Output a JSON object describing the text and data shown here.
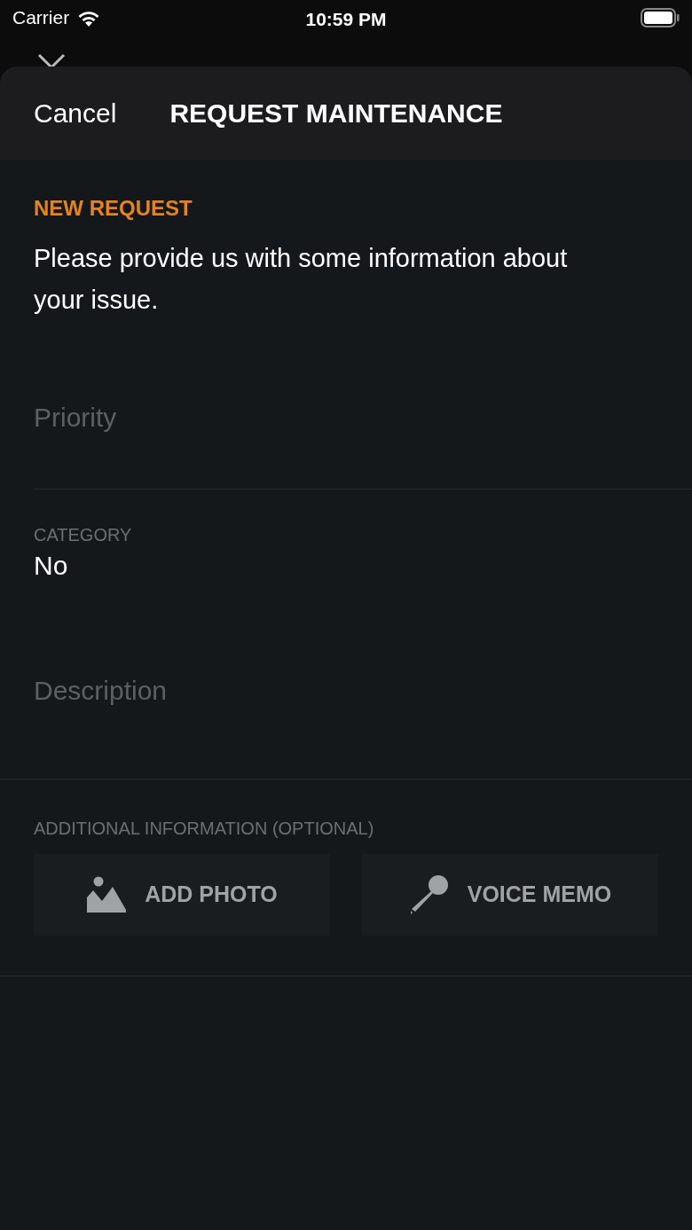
{
  "status_bar": {
    "carrier": "Carrier",
    "time": "10:59 PM"
  },
  "sheet": {
    "cancel": "Cancel",
    "title": "REQUEST MAINTENANCE"
  },
  "section_label": "NEW REQUEST",
  "intro": "Please provide us with some information about your issue.",
  "fields": [
    {
      "kind": "placeholder",
      "placeholder": "Priority"
    },
    {
      "kind": "labeled",
      "label": "CATEGORY",
      "value": "No"
    },
    {
      "kind": "placeholder",
      "placeholder": "Description"
    }
  ],
  "additional": {
    "label": "ADDITIONAL INFORMATION (OPTIONAL)",
    "buttons": [
      {
        "kind": "photo",
        "label": "ADD PHOTO"
      },
      {
        "kind": "voice",
        "label": "VOICE MEMO"
      }
    ]
  }
}
